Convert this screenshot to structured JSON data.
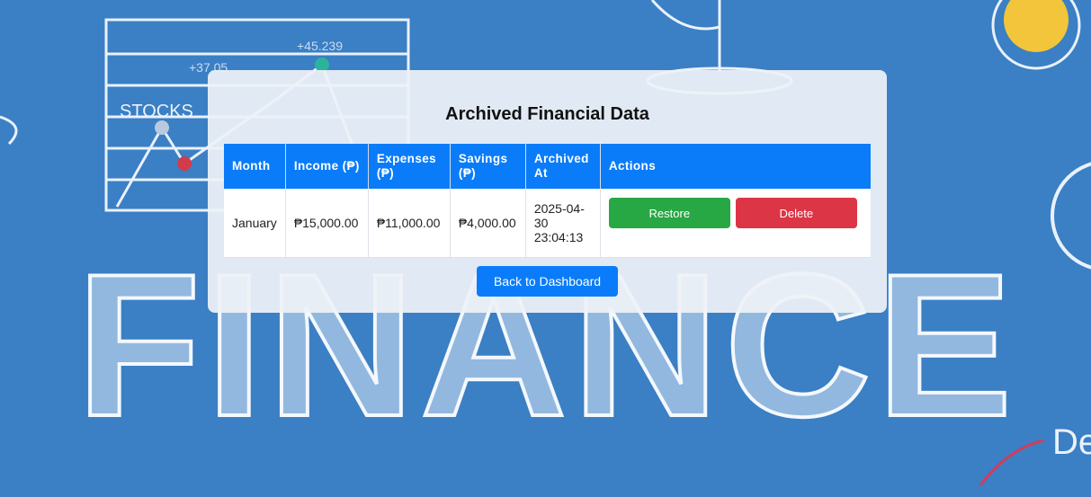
{
  "page": {
    "title": "Archived Financial Data"
  },
  "background": {
    "word": "FINANCE",
    "sketch_label": "STOCKS",
    "sketch_values": [
      "+37.05",
      "+45.239"
    ]
  },
  "table": {
    "headers": [
      "Month",
      "Income (₱)",
      "Expenses (₱)",
      "Savings (₱)",
      "Archived At",
      "Actions"
    ],
    "rows": [
      {
        "month": "January",
        "income": "₱15,000.00",
        "expenses": "₱11,000.00",
        "savings": "₱4,000.00",
        "archived_at": "2025-04-30 23:04:13",
        "restore_label": "Restore",
        "delete_label": "Delete"
      }
    ]
  },
  "back_button_label": "Back to Dashboard",
  "colors": {
    "primary": "#0a7cf9",
    "restore": "#28a745",
    "delete": "#dc3545",
    "background": "#3b7fc4"
  }
}
